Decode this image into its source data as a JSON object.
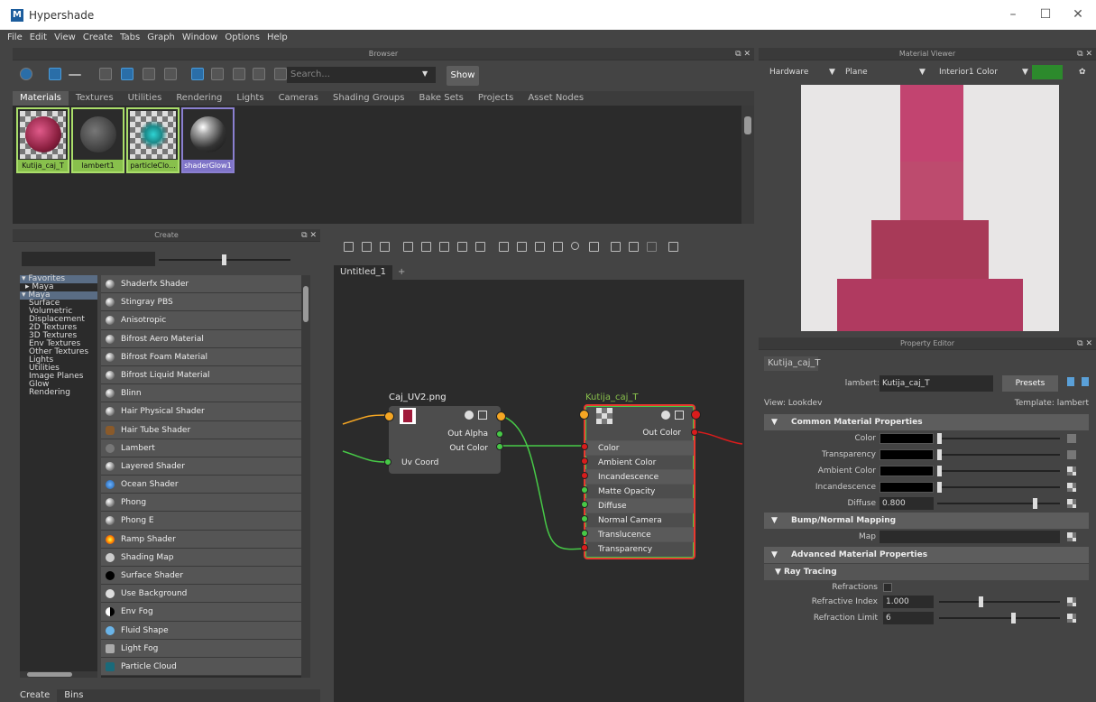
{
  "window": {
    "title": "Hypershade",
    "logo": "M"
  },
  "menu": [
    "File",
    "Edit",
    "View",
    "Create",
    "Tabs",
    "Graph",
    "Window",
    "Options",
    "Help"
  ],
  "browser": {
    "panel_title": "Browser",
    "search_placeholder": "Search...",
    "show_label": "Show",
    "tabs": [
      "Materials",
      "Textures",
      "Utilities",
      "Rendering",
      "Lights",
      "Cameras",
      "Shading Groups",
      "Bake Sets",
      "Projects",
      "Asset Nodes"
    ],
    "swatches": [
      "Kutija_caj_T",
      "lambert1",
      "particleClo...",
      "shaderGlow1"
    ]
  },
  "create": {
    "panel_title": "Create",
    "categories": [
      "Favorites",
      "Maya",
      "Maya",
      "Surface",
      "Volumetric",
      "Displacement",
      "2D Textures",
      "3D Textures",
      "Env Textures",
      "Other Textures",
      "Lights",
      "Utilities",
      "Image Planes",
      "Glow",
      "Rendering"
    ],
    "shaders": [
      "Shaderfx Shader",
      "Stingray PBS",
      "Anisotropic",
      "Bifrost Aero Material",
      "Bifrost Foam Material",
      "Bifrost Liquid Material",
      "Blinn",
      "Hair Physical Shader",
      "Hair Tube Shader",
      "Lambert",
      "Layered Shader",
      "Ocean Shader",
      "Phong",
      "Phong E",
      "Ramp Shader",
      "Shading Map",
      "Surface Shader",
      "Use Background",
      "Env Fog",
      "Fluid Shape",
      "Light Fog",
      "Particle Cloud"
    ],
    "bottom_tabs": [
      "Create",
      "Bins"
    ]
  },
  "graph": {
    "tab": "Untitled_1",
    "add_tab": "+",
    "node1": {
      "title": "Caj_UV2.png",
      "rows": [
        "Out Alpha",
        "Out Color",
        "Uv Coord"
      ]
    },
    "node2": {
      "title": "Kutija_caj_T",
      "header": "Out Color",
      "rows": [
        "Color",
        "Ambient Color",
        "Incandescence",
        "Matte Opacity",
        "Diffuse",
        "Normal Camera",
        "Translucence",
        "Transparency"
      ]
    }
  },
  "viewer": {
    "panel_title": "Material Viewer",
    "renderer": "Hardware",
    "geometry": "Plane",
    "env": "Interior1 Color"
  },
  "prop": {
    "panel_title": "Property Editor",
    "tab": "Kutija_caj_T",
    "type_label": "lambert:",
    "name": "Kutija_caj_T",
    "presets": "Presets",
    "view": "View: Lookdev",
    "template": "Template: lambert",
    "sec_common": "Common Material Properties",
    "color": "Color",
    "transparency": "Transparency",
    "ambient": "Ambient Color",
    "incand": "Incandescence",
    "diffuse": "Diffuse",
    "diffuse_val": "0.800",
    "sec_bump": "Bump/Normal Mapping",
    "map": "Map",
    "sec_adv": "Advanced Material Properties",
    "sec_ray": "Ray Tracing",
    "refractions": "Refractions",
    "ref_index": "Refractive Index",
    "ref_index_val": "1.000",
    "ref_limit": "Refraction Limit",
    "ref_limit_val": "6"
  },
  "colors": {
    "accent": "#88c04c",
    "node_select": "#e8392f",
    "port_green": "#47c947",
    "port_orange": "#f5a623",
    "port_red": "#d91c1c"
  }
}
